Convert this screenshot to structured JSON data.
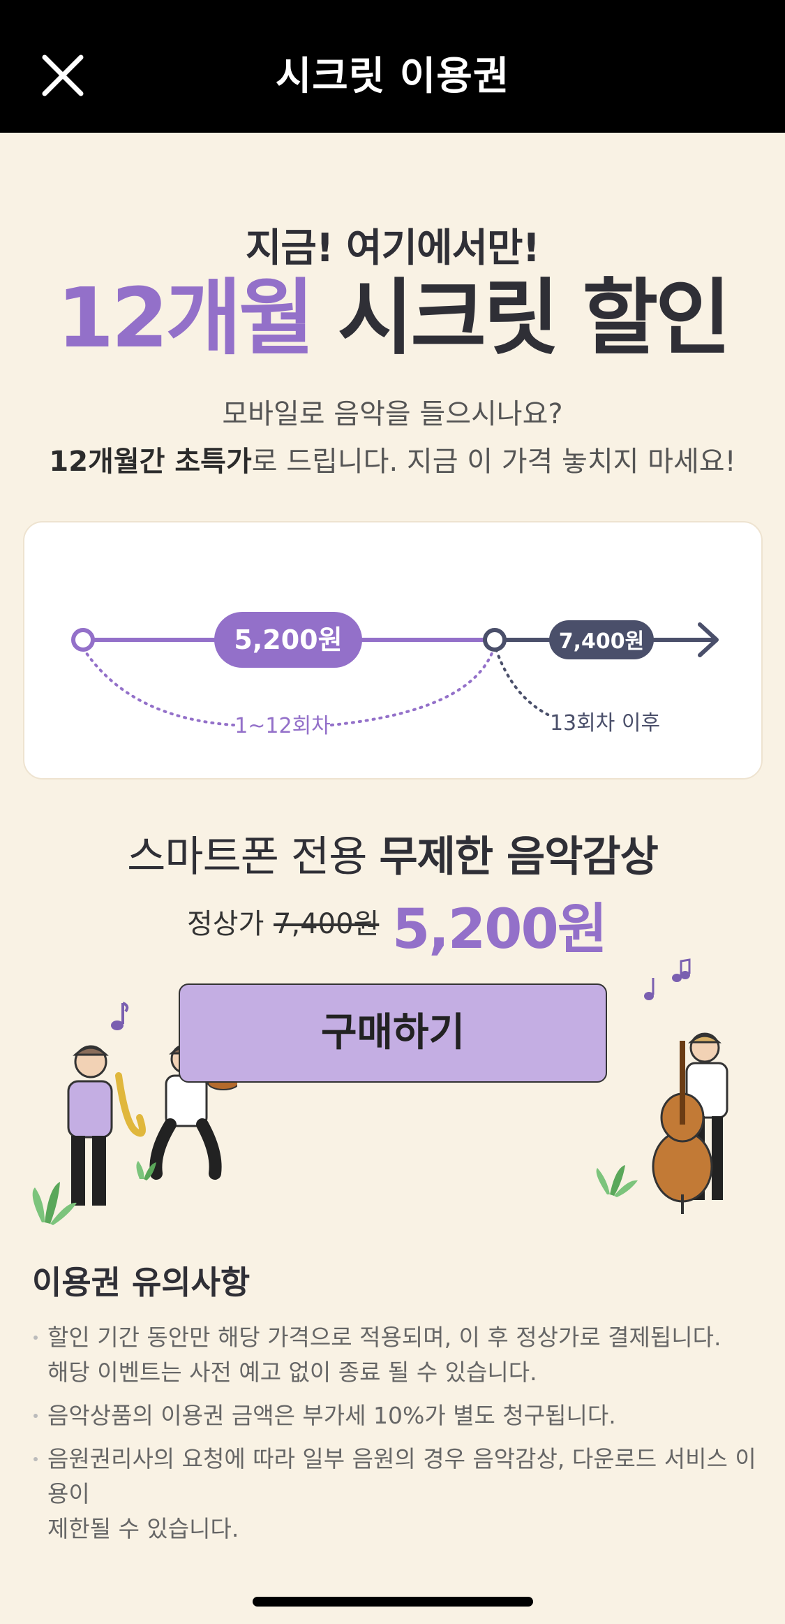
{
  "topbar": {
    "title": "시크릿 이용권",
    "close_icon": "close-icon"
  },
  "headline": {
    "small": "지금! 여기에서만!",
    "big_accent": "12개월",
    "big_dark": "시크릿 할인"
  },
  "subtitle": {
    "line1": "모바일로 음악을 들으시나요?",
    "line2_bold": "12개월간 초특가",
    "line2_rest": "로 드립니다. 지금 이 가격 놓치지 마세요!"
  },
  "timeline": {
    "promo_price": "5,200원",
    "promo_period": "1~12회차",
    "regular_price": "7,400원",
    "regular_period": "13회차 이후"
  },
  "plan": {
    "title_normal": "스마트폰 전용 ",
    "title_bold": "무제한 음악감상",
    "original_label": "정상가",
    "original_price": "7,400원",
    "sale_price": "5,200원",
    "buy_label": "구매하기"
  },
  "notice": {
    "title": "이용권 유의사항",
    "items": [
      {
        "line1": "할인 기간 동안만 해당 가격으로 적용되며, 이 후 정상가로 결제됩니다.",
        "line2": "해당 이벤트는 사전 예고 없이 종료 될 수 있습니다."
      },
      {
        "line1": "음악상품의 이용권 금액은 부가세 10%가 별도 청구됩니다."
      },
      {
        "line1": "음원권리사의 요청에 따라 일부 음원의 경우 음악감상, 다운로드 서비스 이용이",
        "line2": "제한될 수 있습니다."
      }
    ]
  },
  "colors": {
    "background": "#f9f2e4",
    "accent_purple": "#9370c9",
    "button_purple": "#c4aee3",
    "navy": "#4a4f6a"
  }
}
